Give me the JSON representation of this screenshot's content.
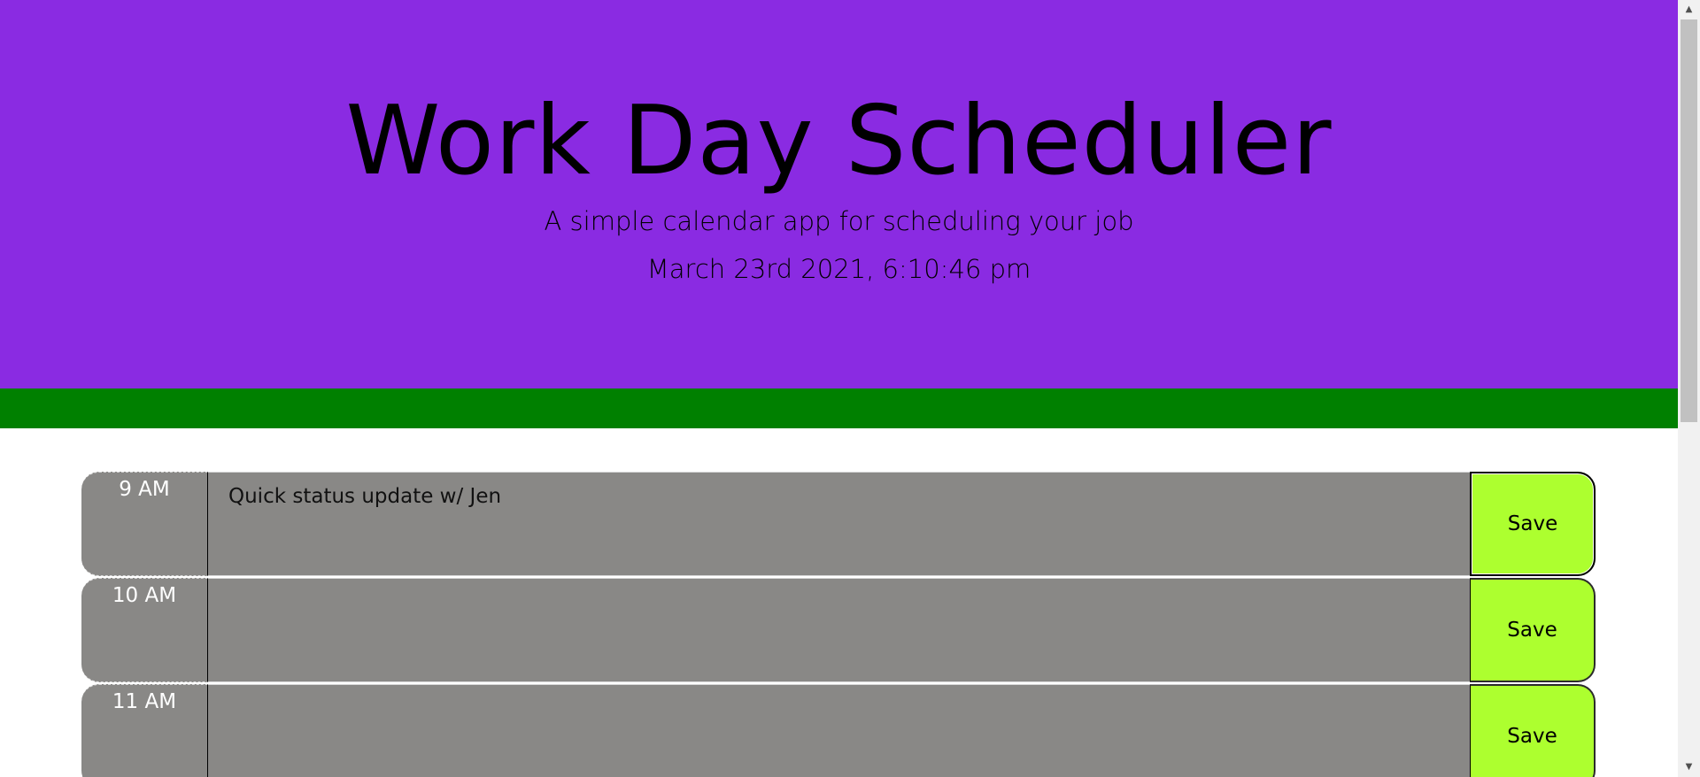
{
  "header": {
    "title": "Work Day Scheduler",
    "subtitle": "A simple calendar app for scheduling your job",
    "current_date": "March 23rd 2021, 6:10:46 pm"
  },
  "time_blocks": [
    {
      "hour": "9 AM",
      "description": "Quick status update w/ Jen",
      "save_label": "Save"
    },
    {
      "hour": "10 AM",
      "description": "",
      "save_label": "Save"
    },
    {
      "hour": "11 AM",
      "description": "",
      "save_label": "Save"
    }
  ],
  "scrollbar": {
    "up_icon": "triangle-up-icon",
    "down_icon": "triangle-down-icon"
  },
  "colors": {
    "header_bg": "#8a2be2",
    "bar_bg": "#008000",
    "block_bg": "#898886",
    "save_bg": "#adff2f"
  }
}
